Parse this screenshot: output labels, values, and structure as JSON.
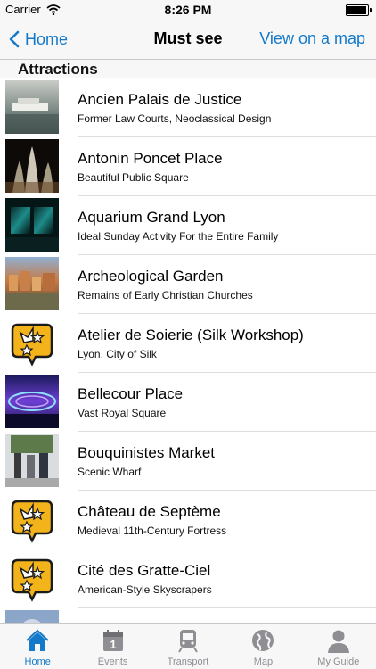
{
  "status_bar": {
    "carrier": "Carrier",
    "time": "8:26 PM",
    "battery_level": 0.95
  },
  "nav": {
    "back_label": "Home",
    "title": "Must see",
    "map_label": "View on a map"
  },
  "section": {
    "title": "Attractions"
  },
  "items": [
    {
      "title": "Ancien Palais de Justice",
      "subtitle": "Former Law Courts, Neoclassical Design",
      "thumb": "boat-river-photo"
    },
    {
      "title": "Antonin Poncet Place",
      "subtitle": "Beautiful Public Square",
      "thumb": "fountain-night-photo"
    },
    {
      "title": "Aquarium Grand Lyon",
      "subtitle": "Ideal Sunday Activity For the Entire Family",
      "thumb": "aquarium-tank-photo"
    },
    {
      "title": "Archeological Garden",
      "subtitle": "Remains of Early Christian Churches",
      "thumb": "city-riverside-photo"
    },
    {
      "title": "Atelier de Soierie (Silk Workshop)",
      "subtitle": "Lyon, City of Silk",
      "thumb": "star-placeholder-icon"
    },
    {
      "title": "Bellecour Place",
      "subtitle": "Vast Royal Square",
      "thumb": "illuminated-ferris-wheel-photo"
    },
    {
      "title": "Bouquinistes Market",
      "subtitle": "Scenic Wharf",
      "thumb": "street-market-photo"
    },
    {
      "title": "Château de Septème",
      "subtitle": "Medieval 11th-Century Fortress",
      "thumb": "star-placeholder-icon"
    },
    {
      "title": "Cité des Gratte-Ciel",
      "subtitle": "American-Style Skyscrapers",
      "thumb": "star-placeholder-icon"
    },
    {
      "title": "",
      "subtitle": "",
      "thumb": "partial-photo"
    }
  ],
  "tabs": [
    {
      "label": "Home",
      "icon": "house-icon",
      "active": true
    },
    {
      "label": "Events",
      "icon": "calendar-icon",
      "active": false
    },
    {
      "label": "Transport",
      "icon": "train-icon",
      "active": false
    },
    {
      "label": "Map",
      "icon": "globe-icon",
      "active": false
    },
    {
      "label": "My Guide",
      "icon": "person-icon",
      "active": false
    }
  ],
  "colors": {
    "accent": "#1479c9",
    "inactive_tab": "#8e8e93",
    "bar_bg": "#f7f7f7",
    "placeholder_yellow": "#f3b31b"
  }
}
